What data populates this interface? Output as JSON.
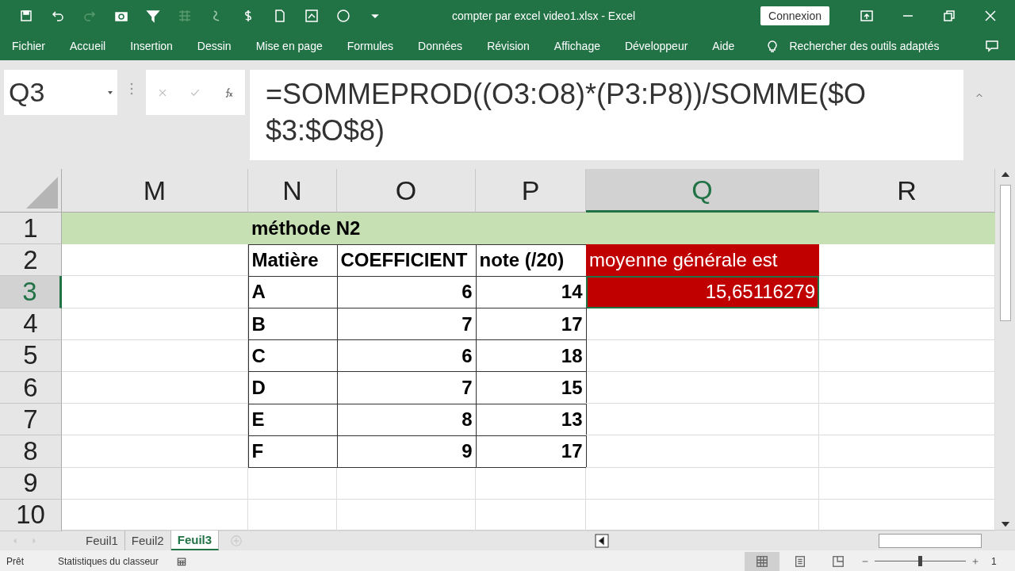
{
  "window": {
    "title": "compter par excel video1.xlsx  -  Excel",
    "account_button": "Connexion"
  },
  "ribbon_tabs": [
    "Fichier",
    "Accueil",
    "Insertion",
    "Dessin",
    "Mise en page",
    "Formules",
    "Données",
    "Révision",
    "Affichage",
    "Développeur",
    "Aide"
  ],
  "tell_me": "Rechercher des outils adaptés",
  "name_box": "Q3",
  "formula": "=SOMMEPROD((O3:O8)*(P3:P8))/SOMME($O$3:$O$8)",
  "columns": [
    {
      "label": "M",
      "selected": false
    },
    {
      "label": "N",
      "selected": false
    },
    {
      "label": "O",
      "selected": false
    },
    {
      "label": "P",
      "selected": false
    },
    {
      "label": "Q",
      "selected": true
    },
    {
      "label": "R",
      "selected": false
    }
  ],
  "rows": [
    {
      "number": "1",
      "selected": false,
      "kind": "band",
      "cells": [
        {
          "kind": "empty"
        },
        {
          "kind": "title",
          "text": "méthode N2"
        },
        {
          "kind": "empty"
        },
        {
          "kind": "empty"
        },
        {
          "kind": "empty"
        },
        {
          "kind": "empty"
        }
      ]
    },
    {
      "number": "2",
      "selected": false,
      "kind": "normal",
      "cells": [
        {
          "kind": "empty"
        },
        {
          "kind": "label",
          "text": "Matière"
        },
        {
          "kind": "label",
          "text": "COEFFICIENT"
        },
        {
          "kind": "label",
          "text": "note (/20)"
        },
        {
          "kind": "result_label",
          "text": "moyenne générale est"
        },
        {
          "kind": "empty"
        }
      ]
    },
    {
      "number": "3",
      "selected": true,
      "kind": "normal",
      "cells": [
        {
          "kind": "empty"
        },
        {
          "kind": "label",
          "text": "A"
        },
        {
          "kind": "number",
          "text": "6"
        },
        {
          "kind": "number",
          "text": "14"
        },
        {
          "kind": "result",
          "text": "15,65116279"
        },
        {
          "kind": "empty"
        }
      ]
    },
    {
      "number": "4",
      "selected": false,
      "kind": "normal",
      "cells": [
        {
          "kind": "empty"
        },
        {
          "kind": "label",
          "text": "B"
        },
        {
          "kind": "number",
          "text": "7"
        },
        {
          "kind": "number",
          "text": "17"
        },
        {
          "kind": "empty"
        },
        {
          "kind": "empty"
        }
      ]
    },
    {
      "number": "5",
      "selected": false,
      "kind": "normal",
      "cells": [
        {
          "kind": "empty"
        },
        {
          "kind": "label",
          "text": "C"
        },
        {
          "kind": "number",
          "text": "6"
        },
        {
          "kind": "number",
          "text": "18"
        },
        {
          "kind": "empty"
        },
        {
          "kind": "empty"
        }
      ]
    },
    {
      "number": "6",
      "selected": false,
      "kind": "normal",
      "cells": [
        {
          "kind": "empty"
        },
        {
          "kind": "label",
          "text": "D"
        },
        {
          "kind": "number",
          "text": "7"
        },
        {
          "kind": "number",
          "text": "15"
        },
        {
          "kind": "empty"
        },
        {
          "kind": "empty"
        }
      ]
    },
    {
      "number": "7",
      "selected": false,
      "kind": "normal",
      "cells": [
        {
          "kind": "empty"
        },
        {
          "kind": "label",
          "text": "E"
        },
        {
          "kind": "number",
          "text": "8"
        },
        {
          "kind": "number",
          "text": "13"
        },
        {
          "kind": "empty"
        },
        {
          "kind": "empty"
        }
      ]
    },
    {
      "number": "8",
      "selected": false,
      "kind": "normal",
      "cells": [
        {
          "kind": "empty"
        },
        {
          "kind": "label",
          "text": "F"
        },
        {
          "kind": "number",
          "text": "9"
        },
        {
          "kind": "number",
          "text": "17"
        },
        {
          "kind": "empty"
        },
        {
          "kind": "empty"
        }
      ]
    },
    {
      "number": "9",
      "selected": false,
      "kind": "normal",
      "cells": [
        {
          "kind": "empty"
        },
        {
          "kind": "empty"
        },
        {
          "kind": "empty"
        },
        {
          "kind": "empty"
        },
        {
          "kind": "empty"
        },
        {
          "kind": "empty"
        }
      ]
    },
    {
      "number": "10",
      "selected": false,
      "kind": "normal",
      "cells": [
        {
          "kind": "empty"
        },
        {
          "kind": "empty"
        },
        {
          "kind": "empty"
        },
        {
          "kind": "empty"
        },
        {
          "kind": "empty"
        },
        {
          "kind": "empty"
        }
      ]
    }
  ],
  "sheets": [
    {
      "label": "Feuil1",
      "selected": false
    },
    {
      "label": "Feuil2",
      "selected": false
    },
    {
      "label": "Feuil3",
      "selected": true
    }
  ],
  "status_bar": {
    "state": "Prêt",
    "stats": "Statistiques du classeur",
    "zoom": "1"
  }
}
